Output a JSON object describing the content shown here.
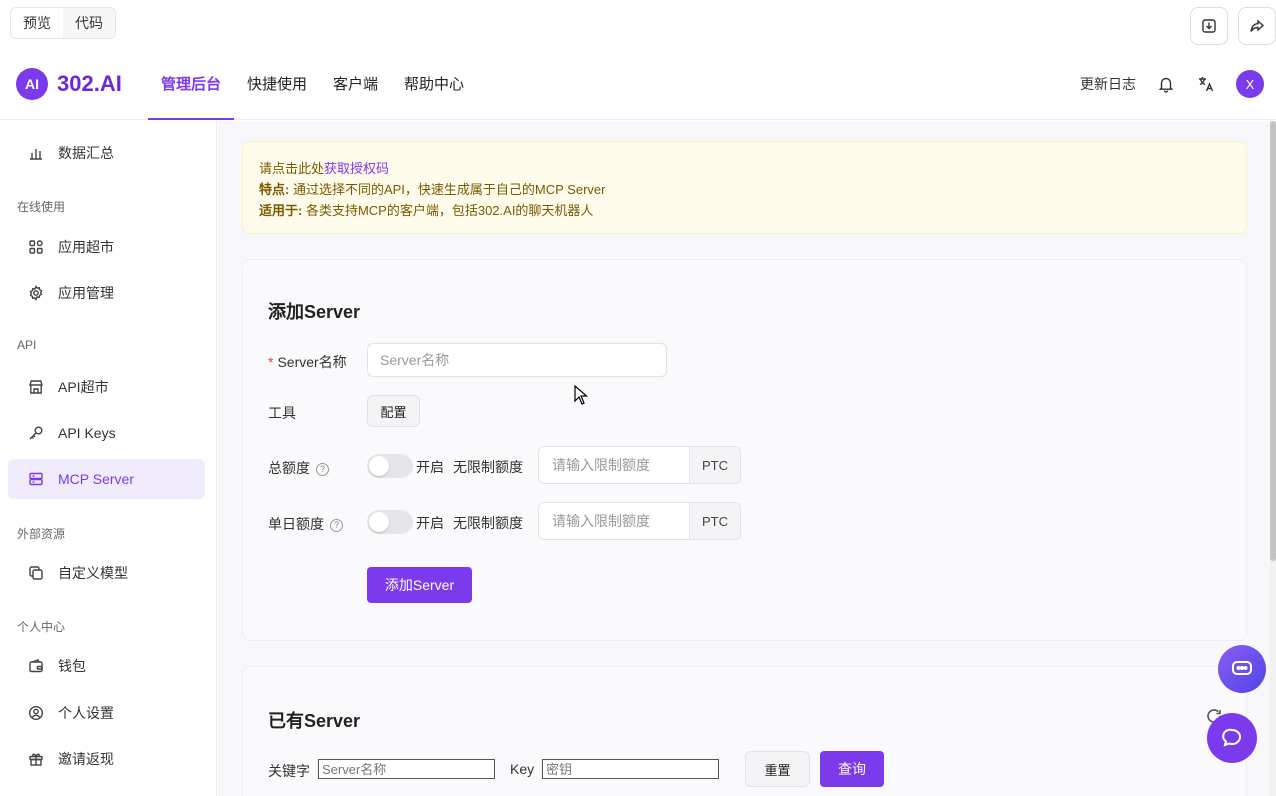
{
  "topbar": {
    "tabs": [
      {
        "label": "预览"
      },
      {
        "label": "代码"
      }
    ],
    "icons": [
      "download-icon",
      "share-icon"
    ]
  },
  "header": {
    "logo_mark": "AI",
    "logo_text": "302.AI",
    "nav": [
      {
        "label": "管理后台",
        "active": true
      },
      {
        "label": "快捷使用"
      },
      {
        "label": "客户端"
      },
      {
        "label": "帮助中心"
      }
    ],
    "changelog": "更新日志",
    "avatar_letter": "X"
  },
  "sidebar": {
    "items": [
      {
        "label": "数据汇总",
        "icon": "bar-chart-icon"
      },
      {
        "label": "应用超市",
        "icon": "apps-icon"
      },
      {
        "label": "应用管理",
        "icon": "gear-icon"
      },
      {
        "label": "API超市",
        "icon": "store-icon"
      },
      {
        "label": "API Keys",
        "icon": "key-icon"
      },
      {
        "label": "MCP Server",
        "icon": "server-icon",
        "active": true
      },
      {
        "label": "自定义模型",
        "icon": "copy-icon"
      },
      {
        "label": "钱包",
        "icon": "wallet-icon"
      },
      {
        "label": "个人设置",
        "icon": "user-icon"
      },
      {
        "label": "邀请返现",
        "icon": "gift-icon"
      }
    ],
    "groups": [
      "在线使用",
      "API",
      "外部资源",
      "个人中心"
    ]
  },
  "notice": {
    "line1_prefix": "请点击此处",
    "line1_link": "获取授权码",
    "line2_label": "特点:",
    "line2_text": " 通过选择不同的API，快速生成属于自己的MCP Server",
    "line3_label": "适用于:",
    "line3_text": " 各类支持MCP的客户端，包括302.AI的聊天机器人"
  },
  "add_server": {
    "title": "添加Server",
    "name_label": "Server名称",
    "name_placeholder": "Server名称",
    "tool_label": "工具",
    "config_button": "配置",
    "total_label": "总额度",
    "daily_label": "单日额度",
    "toggle_on_text": "开启",
    "unlimited_text": "无限制额度",
    "limit_placeholder": "请输入限制额度",
    "unit": "PTC",
    "submit": "添加Server"
  },
  "existing": {
    "title": "已有Server",
    "keyword_label": "关键字",
    "keyword_placeholder": "Server名称",
    "key_label": "Key",
    "key_placeholder": "密钥",
    "reset": "重置",
    "query": "查询"
  },
  "colors": {
    "accent": "#7c3aed",
    "notice_bg": "#fffbea",
    "notice_text": "#7a5a00"
  }
}
